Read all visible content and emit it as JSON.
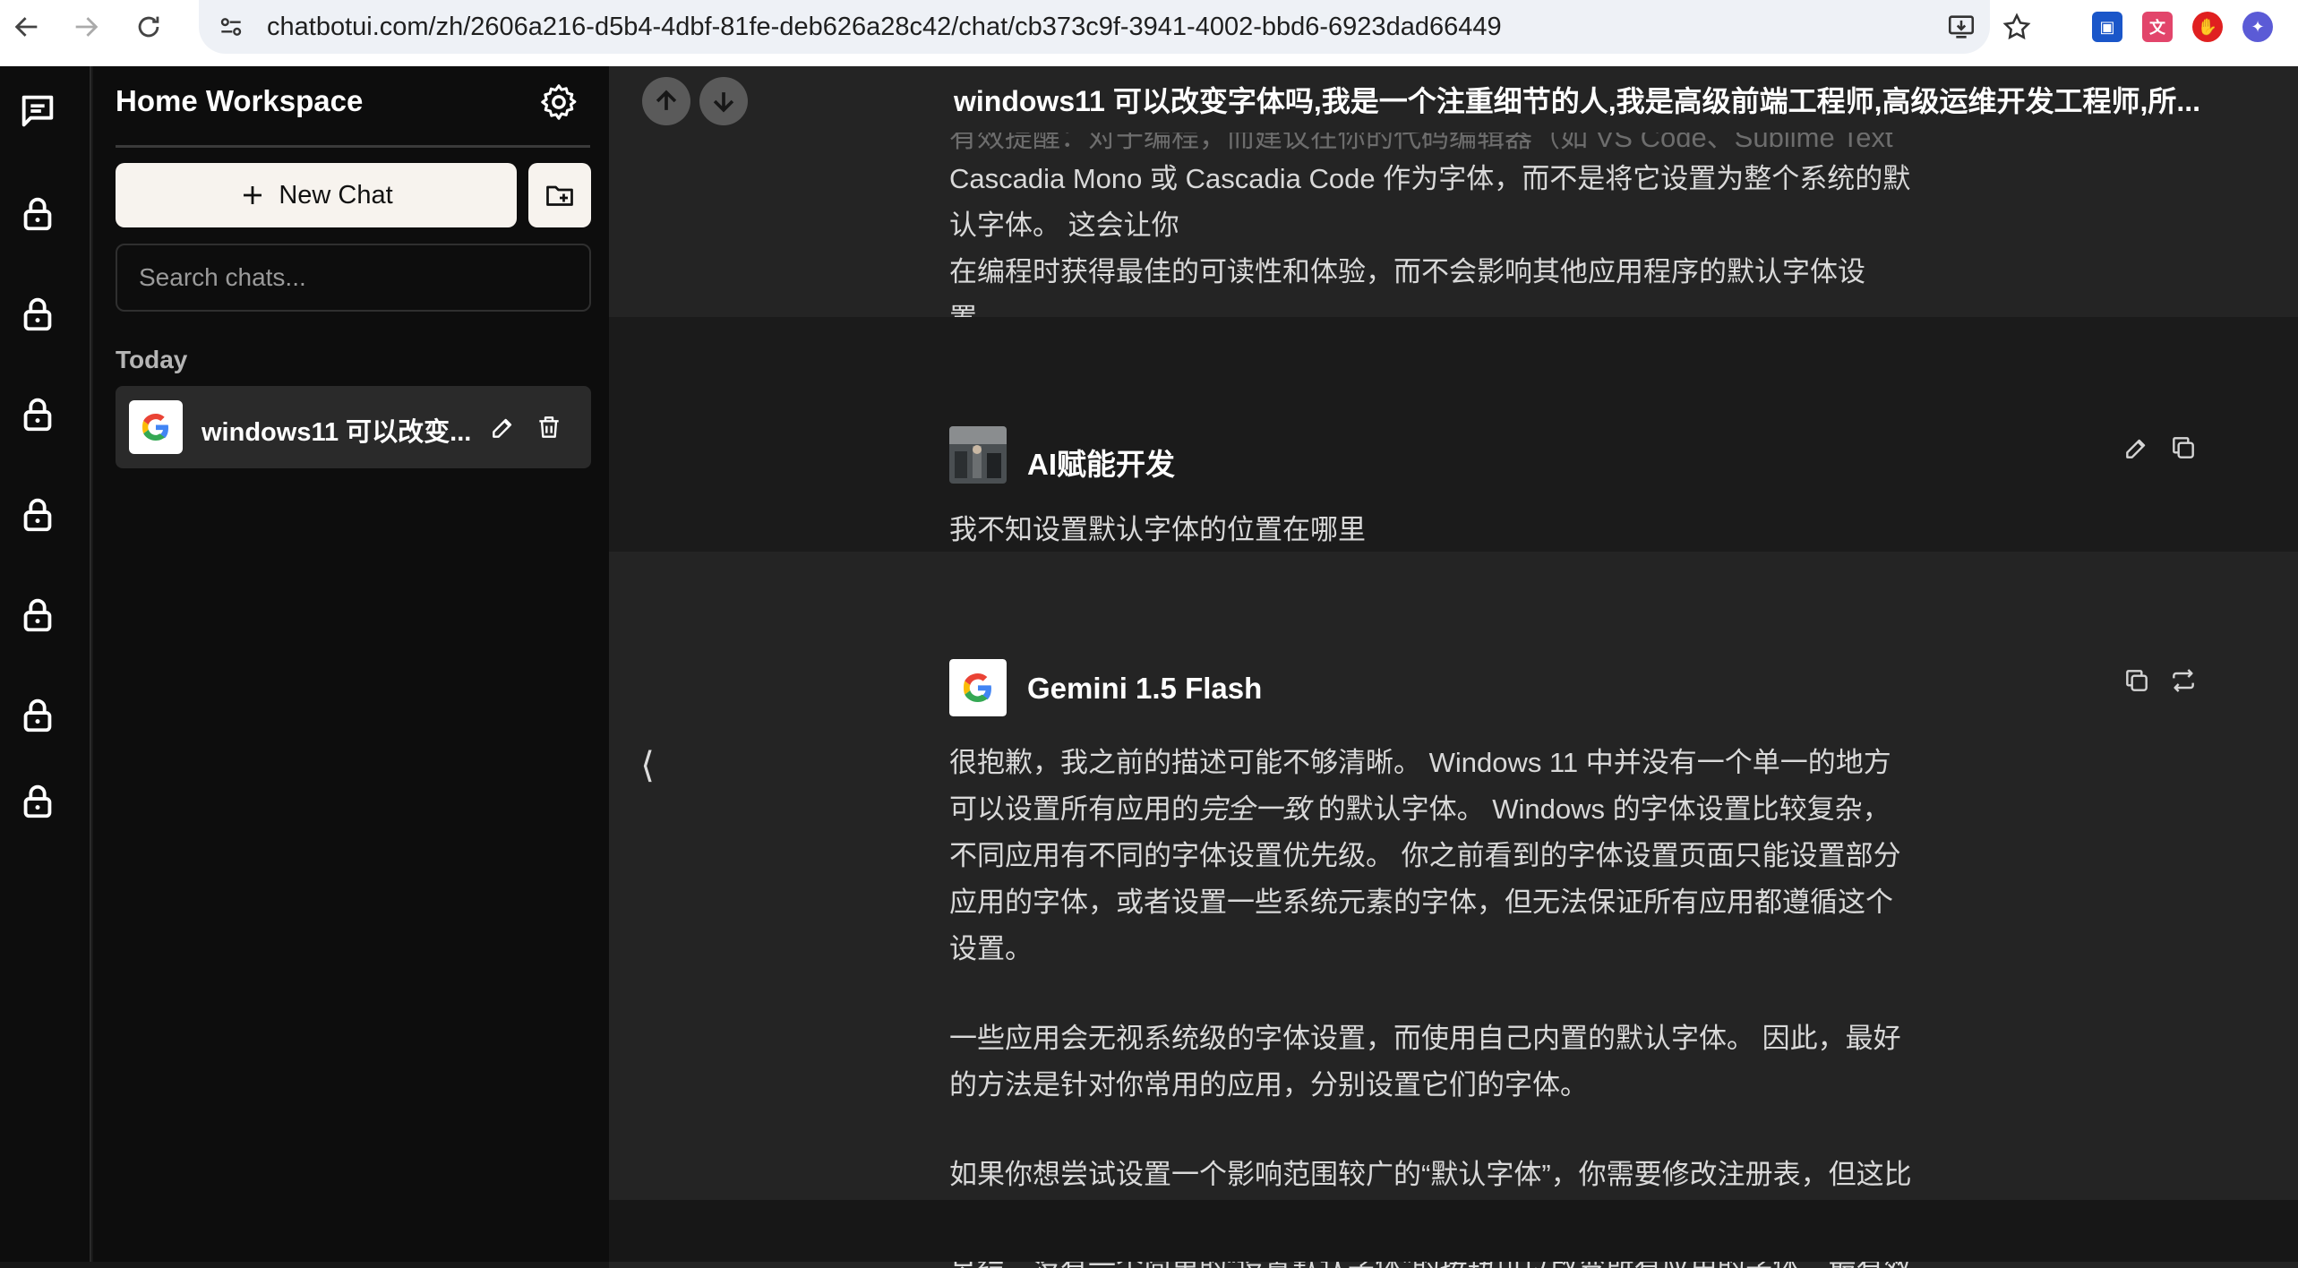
{
  "browser": {
    "url": "chatbotui.com/zh/2606a216-d5b4-4dbf-81fe-deb626a28c42/chat/cb373c9f-3941-4002-bbd6-6923dad66449",
    "extensions": [
      "lock-ext",
      "translate-ext",
      "adblock-ext",
      "chatgpt-ext"
    ]
  },
  "sidebar": {
    "workspace_title": "Home Workspace",
    "new_chat_label": "New Chat",
    "search_placeholder": "Search chats...",
    "section_today": "Today",
    "chats": [
      {
        "title": "windows11 可以改变..."
      }
    ]
  },
  "main": {
    "conversation_title": "windows11 可以改变字体吗,我是一个注重细节的人,我是高级前端工程师,高级运维开发工程师,所...",
    "partial_top_text": "有效提醒：对于编程，而建议在你的代码编辑器（如 VS Code、Sublime Text 等）中单独设置",
    "prev_message_lines": [
      "Cascadia Mono 或 Cascadia Code 作为字体，而不是将它设置为整个系统的默认字体。 这会让你",
      "在编程时获得最佳的可读性和体验，而不会影响其他应用程序的默认字体设置。"
    ],
    "user_message": {
      "author": "AI赋能开发",
      "text": "我不知设置默认字体的位置在哪里"
    },
    "assistant_message": {
      "author": "Gemini 1.5 Flash",
      "para1_a": "很抱歉，我之前的描述可能不够清晰。 Windows 11 中并没有一个单一的地方可以设置所有应用的",
      "para1_em": "完全一致",
      "para1_b": " 的默认字体。 Windows 的字体设置比较复杂，不同应用有不同的字体设置优先级。 你之前看到的字体设置页面只能设置部分应用的字体，或者设置一些系统元素的字体，但无法保证所有应用都遵循这个设置。",
      "para2": "一些应用会无视系统级的字体设置，而使用自己内置的默认字体。 因此，最好的方法是针对你常用的应用，分别设置它们的字体。",
      "para3": "如果你想尝试设置一个影响范围较广的“默认字体”，你需要修改注册表，但这比较危险，不建议没有经验的用户操作。 错误操作可能会导致系统不稳定。",
      "partial_bottom": "总结：没有一个简单的“设置默认字体”的按钮可以改变所有应用的字体。最有效的方法是针对每个"
    },
    "collapse_glyph": "⟨"
  }
}
